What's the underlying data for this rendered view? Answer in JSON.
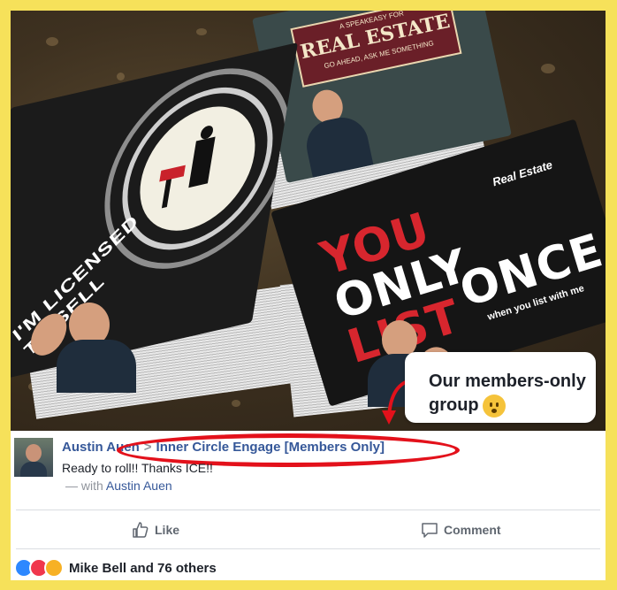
{
  "photo": {
    "card_left_text": "I'M LICENSED\nTO SELL",
    "card_top_small": "A SPEAKEASY FOR",
    "card_top_title": "REAL ESTATE",
    "card_top_tagline": "GO AHEAD, ASK ME SOMETHING",
    "card_right_lines": [
      "YOU",
      "ONLY",
      "LIST",
      "ONCE"
    ],
    "card_right_tagline": "when you list with me",
    "card_right_brand": "Real Estate"
  },
  "callout": {
    "text": "Our members-only group"
  },
  "post": {
    "author": "Austin Auen",
    "separator": ">",
    "group": "Inner Circle Engage [Members Only]",
    "message": "Ready to roll!! Thanks ICE!!",
    "with_prefix": "— with",
    "with_name": "Austin Auen"
  },
  "actions": {
    "like_label": "Like",
    "comment_label": "Comment"
  },
  "reactions": {
    "summary": "Mike Bell and 76 others"
  },
  "colors": {
    "frame_border": "#f6e15a",
    "link_blue": "#365899",
    "highlight_red": "#e3111b",
    "yolo_red": "#d7262e"
  }
}
